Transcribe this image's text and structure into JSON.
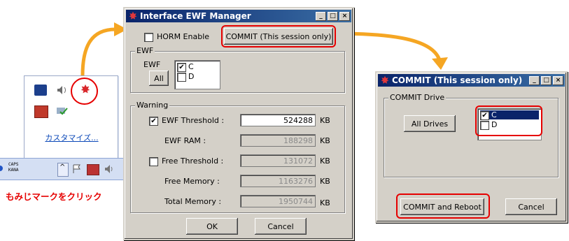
{
  "tray": {
    "customize_label": "カスタマイズ...",
    "caps_line1": "CAPS",
    "caps_line2": "KANA",
    "instruction": "もみじマークをクリック"
  },
  "ewf_manager": {
    "title": "Interface EWF Manager",
    "horm_label": "HORM Enable",
    "horm_checked": false,
    "commit_button": "COMMIT (This session only)",
    "ewf_group": "EWF",
    "ewf_label": "EWF",
    "all_button": "All",
    "drives": [
      {
        "label": "C",
        "checked": true
      },
      {
        "label": "D",
        "checked": false
      }
    ],
    "warning_group": "Warning",
    "rows": [
      {
        "label": "EWF Threshold :",
        "value": "524288",
        "unit": "KB",
        "checkbox": true,
        "checked": true,
        "enabled": true
      },
      {
        "label": "EWF RAM :",
        "value": "188298",
        "unit": "KB",
        "checkbox": false,
        "enabled": false
      },
      {
        "label": "Free Threshold :",
        "value": "131072",
        "unit": "KB",
        "checkbox": true,
        "checked": false,
        "enabled": false
      },
      {
        "label": "Free Memory :",
        "value": "1163276",
        "unit": "KB",
        "checkbox": false,
        "enabled": false
      },
      {
        "label": "Total Memory :",
        "value": "1950744",
        "unit": "KB",
        "checkbox": false,
        "enabled": false
      }
    ],
    "ok_button": "OK",
    "cancel_button": "Cancel"
  },
  "commit_dialog": {
    "title": "COMMIT (This session only)",
    "group_label": "COMMIT Drive",
    "all_drives_button": "All Drives",
    "drives": [
      {
        "label": "C",
        "checked": true,
        "selected": true
      },
      {
        "label": "D",
        "checked": false,
        "selected": false
      }
    ],
    "reboot_button": "COMMIT and Reboot",
    "cancel_button": "Cancel"
  },
  "colors": {
    "highlight_red": "#e60000",
    "arrow_orange": "#f5a623",
    "title_blue": "#0a246a",
    "dialog_gray": "#d4d0c8"
  }
}
